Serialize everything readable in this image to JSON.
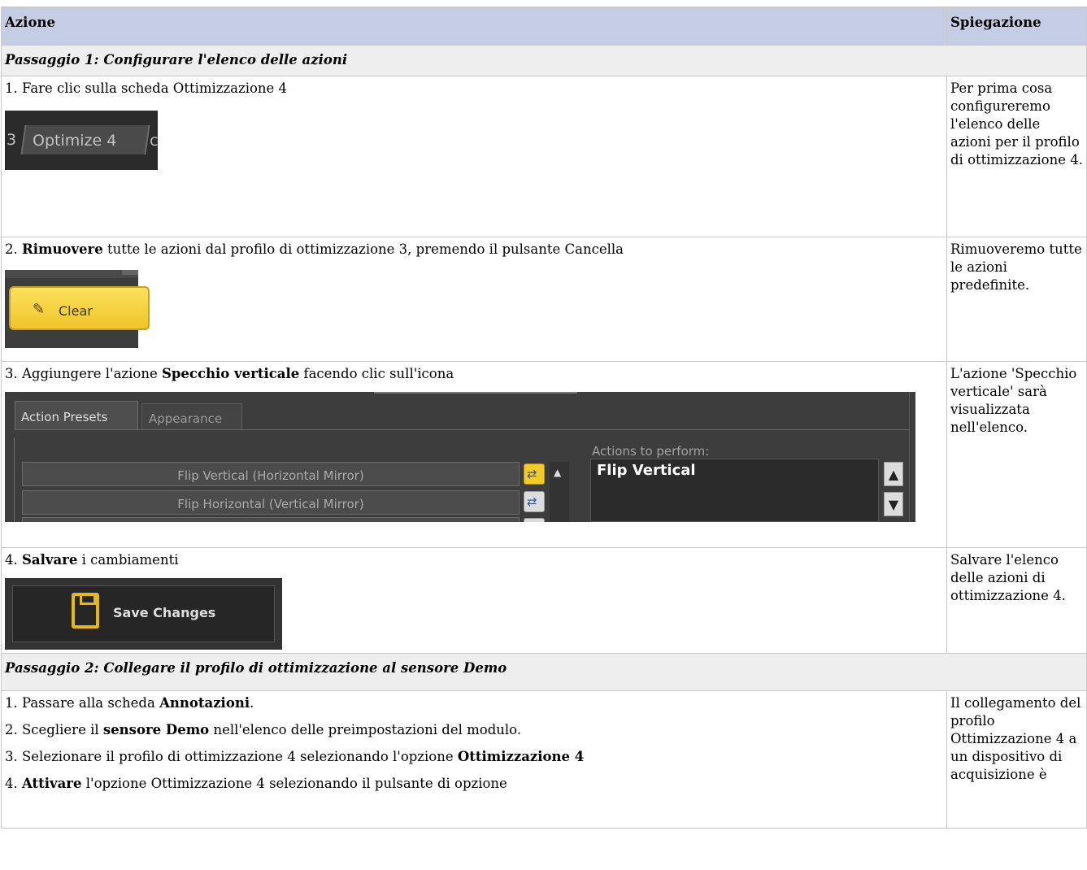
{
  "header": {
    "col_action": "Azione",
    "col_explanation": "Spiegazione"
  },
  "step1": {
    "title": "Passaggio 1: Configurare l'elenco delle azioni",
    "rows": [
      {
        "text": "1. Fare clic sulla scheda Ottimizzazione 4",
        "explanation": "Per prima cosa configureremo l'elenco delle azioni per il profilo di ottimizzazione 4.",
        "shot": {
          "prev_tab_suffix": "3",
          "tab_label": "Optimize 4",
          "next_tab_prefix": "c"
        }
      },
      {
        "text_num": "2.",
        "text_bold": "Rimuovere",
        "text_rest": "tutte le azioni dal profilo di ottimizzazione 3, premendo il pulsante Cancella",
        "explanation": "Rimuoveremo tutte le azioni predefinite.",
        "shot": {
          "button_label": "Clear",
          "icon": "broom-icon"
        }
      },
      {
        "text_num": "3. Aggiungere l'azione",
        "text_bold": "Specchio verticale",
        "text_rest": "facendo clic sull'icona",
        "explanation": "L'azione 'Specchio verticale' sarà visualizzata nell'elenco.",
        "shot": {
          "tabs": [
            "Action Presets",
            "Appearance"
          ],
          "presets": [
            "Flip Vertical (Horizontal Mirror)",
            "Flip Horizontal (Vertical Mirror)"
          ],
          "actions_label": "Actions to perform:",
          "actions": [
            "Flip Vertical"
          ]
        }
      },
      {
        "text_num": "4.",
        "text_bold": "Salvare",
        "text_rest": "i cambiamenti",
        "explanation": "Salvare l'elenco delle azioni di ottimizzazione 4.",
        "shot": {
          "button_label": "Save Changes",
          "icon": "floppy-disk-icon"
        }
      }
    ]
  },
  "step2": {
    "title": "Passaggio 2: Collegare il profilo di ottimizzazione al sensore Demo",
    "lines": [
      {
        "pre": "1. Passare alla scheda",
        "bold": "Annotazioni",
        "post": "."
      },
      {
        "pre": "2. Scegliere il",
        "bold": "sensore Demo",
        "post": "nell'elenco delle preimpostazioni del modulo."
      },
      {
        "pre": "3. Selezionare il profilo di ottimizzazione 4 selezionando l'opzione",
        "bold": "Ottimizzazione 4",
        "post": ""
      },
      {
        "pre": "4.",
        "bold": "Attivare",
        "post": "l'opzione Ottimizzazione 4 selezionando il pulsante di opzione"
      }
    ],
    "explanation": "Il collegamento del profilo Ottimizzazione 4 a un dispositivo di acquisizione è"
  }
}
